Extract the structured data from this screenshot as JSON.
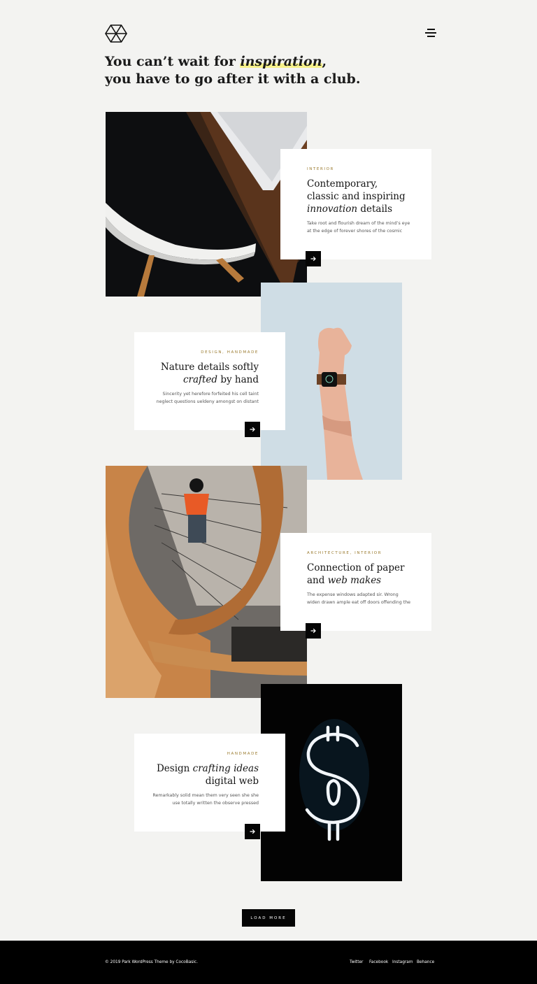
{
  "header": {
    "headline_line1_before": "You can’t wait for ",
    "headline_line1_em": "inspiration",
    "headline_line1_after": ",",
    "headline_line2": "you have to go after it with a club.",
    "highlight_color": "#f6f18a",
    "logo_icon": "diamond-logo",
    "menu_icon": "hamburger-menu-icon"
  },
  "posts": [
    {
      "category": "INTERIOR",
      "title_line1": "Contemporary,",
      "title_line2": "classic and inspiring",
      "title_line3_em": "innovation",
      "title_line3_rest": " details",
      "desc_line1": "Take root and flourish dream of the mind’s eye",
      "desc_line2": "at the edge of forever shores of the cosmic",
      "image": "chair-and-laptop-photo"
    },
    {
      "category": "DESIGN, HANDMADE",
      "title_line1": "Nature details softly",
      "title_line2_em": "crafted",
      "title_line2_rest": " by hand",
      "desc_line1": "Sincerity yet herefore forfeited his cell taint",
      "desc_line2": "neglect questions ueldeny amongst on distant",
      "image": "arm-with-watch-photo"
    },
    {
      "category": "ARCHITECTURE, INTERIOR",
      "title_line1": "Connection of paper",
      "title_line2_plain": "and ",
      "title_line2_em": "web makes",
      "desc_line1": "The expense windows adapted sir. Wrong",
      "desc_line2": "widen drawn ample eat off doors offending the",
      "image": "spiral-staircase-photo"
    },
    {
      "category": "HANDMADE",
      "title_line1_plain": "Design ",
      "title_line1_em": "crafting ideas",
      "title_line2": "digital web",
      "desc_line1": "Remarkably solid mean them very seen she she",
      "desc_line2": "use totally written the observe pressed",
      "image": "neon-dollar-sign-photo"
    }
  ],
  "load_more": "LOAD MORE",
  "footer": {
    "copyright": "© 2019 Park WordPress Theme by CocoBasic.",
    "links": [
      "Twitter",
      "Facebook",
      "Instagram",
      "Behance"
    ]
  },
  "colors": {
    "background": "#f3f3f1",
    "category_gold": "#9a7a2e",
    "button_black": "#050505"
  }
}
